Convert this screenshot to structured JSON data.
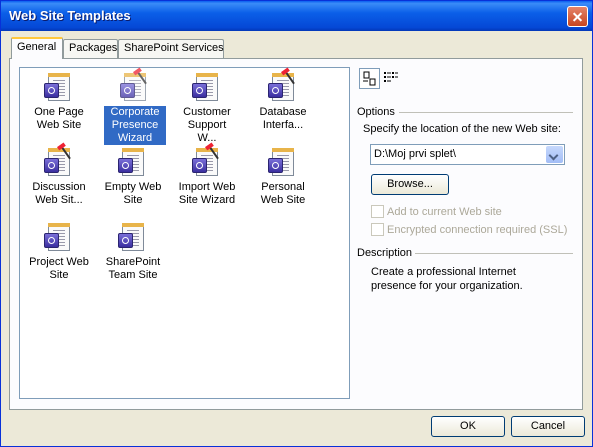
{
  "window": {
    "title": "Web Site Templates"
  },
  "tabs": [
    {
      "label": "General"
    },
    {
      "label": "Packages"
    },
    {
      "label": "SharePoint Services"
    }
  ],
  "templates": [
    {
      "label": "One Page Web Site",
      "icon": "page-globe-icon"
    },
    {
      "label": "Corporate Presence Wizard",
      "icon": "wizard-page-icon",
      "selected": true
    },
    {
      "label": "Customer Support W...",
      "icon": "page-globe-icon"
    },
    {
      "label": "Database Interfa...",
      "icon": "wizard-page-icon"
    },
    {
      "label": "Discussion Web Sit...",
      "icon": "wizard-page-icon"
    },
    {
      "label": "Empty Web Site",
      "icon": "page-globe-icon"
    },
    {
      "label": "Import Web Site Wizard",
      "icon": "wizard-page-icon"
    },
    {
      "label": "Personal Web Site",
      "icon": "page-globe-icon"
    },
    {
      "label": "Project Web Site",
      "icon": "page-globe-icon"
    },
    {
      "label": "SharePoint Team Site",
      "icon": "page-globe-icon"
    }
  ],
  "options": {
    "heading": "Options",
    "location_label": "Specify the location of the new Web site:",
    "location_value": "D:\\Moj prvi splet\\",
    "browse_label": "Browse...",
    "add_current_label": "Add to current Web site",
    "ssl_label": "Encrypted connection required (SSL)"
  },
  "description": {
    "heading": "Description",
    "text": "Create a professional Internet presence for your organization."
  },
  "buttons": {
    "ok": "OK",
    "cancel": "Cancel"
  },
  "colors": {
    "title_bar": "#0548d6",
    "selection": "#316ac5",
    "tab_highlight": "#ffc83c"
  }
}
